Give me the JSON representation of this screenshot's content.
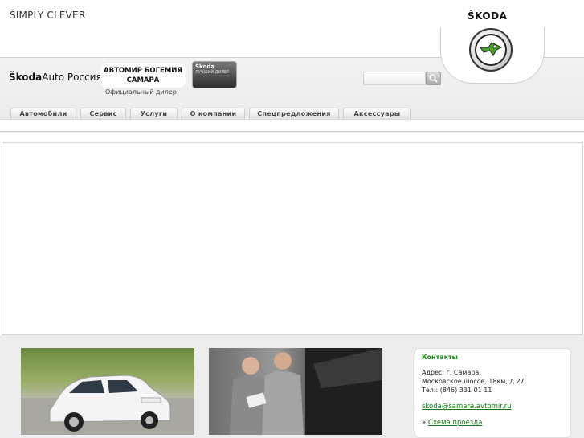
{
  "topbar": {
    "slogan": "SIMPLY CLEVER",
    "brand": "ŠKODA"
  },
  "header": {
    "skoda_auto_bold": "Škoda",
    "skoda_auto_rest": "Auto Россия",
    "dealer_line1": "АВТОМИР БОГЕМИЯ",
    "dealer_line2": "САМАРА",
    "dealer_sub": "Официальный дилер",
    "badge_title": "Škoda",
    "badge_text": "ЛУЧШИЙ ДИЛЕР"
  },
  "search": {
    "placeholder": ""
  },
  "nav": {
    "tabs": [
      {
        "label": "Автомобили"
      },
      {
        "label": "Сервис"
      },
      {
        "label": "Услуги"
      },
      {
        "label": "О компании"
      },
      {
        "label": "Спецпредложения"
      },
      {
        "label": "Аксессуары"
      }
    ]
  },
  "contacts": {
    "title": "Контакты",
    "address1": "Адрес: г. Самара,",
    "address2": "Московское шоссе, 18км, д.27,",
    "phone": "Тел.: (846) 331 01 11",
    "email": "skoda@samara.avtomir.ru",
    "map_prefix": "»",
    "map_link": "Схема проезда"
  },
  "colors": {
    "accent_green": "#1b8a1b",
    "logo_green": "#4aa02c",
    "header_grey": "#ececec"
  },
  "icons": {
    "search": "search-icon",
    "logo": "skoda-arrow-logo-icon"
  }
}
